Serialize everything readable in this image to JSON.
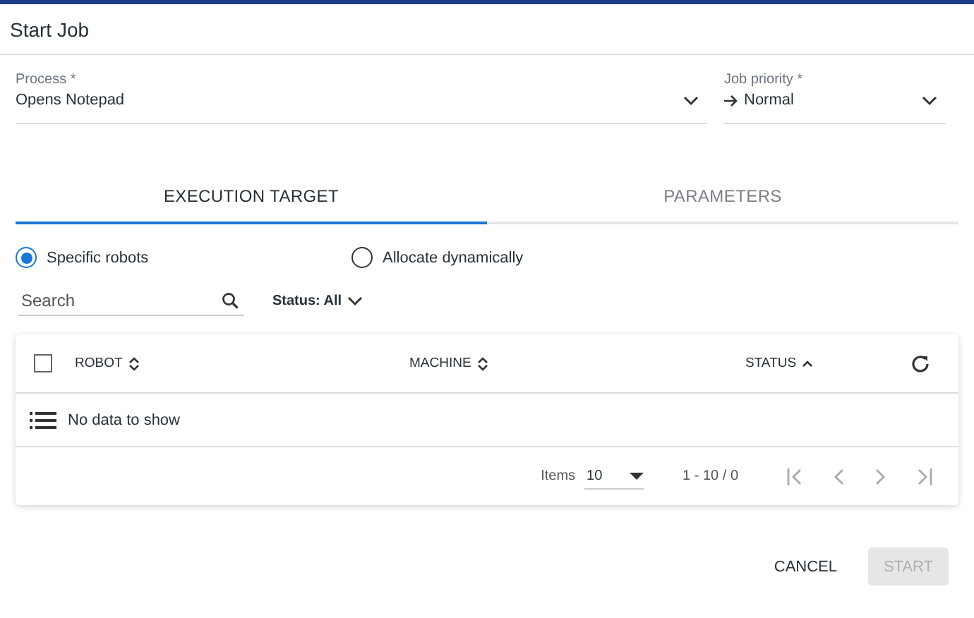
{
  "dialog": {
    "title": "Start Job"
  },
  "process": {
    "label": "Process *",
    "value": "Opens Notepad"
  },
  "priority": {
    "label": "Job priority *",
    "value": "Normal"
  },
  "tabs": [
    {
      "label": "EXECUTION TARGET",
      "selected": true
    },
    {
      "label": "PARAMETERS",
      "selected": false
    }
  ],
  "target_options": [
    {
      "label": "Specific robots",
      "selected": true
    },
    {
      "label": "Allocate dynamically",
      "selected": false
    }
  ],
  "search": {
    "placeholder": "Search"
  },
  "status_filter": "Status: All",
  "table": {
    "all_checked": false,
    "columns": [
      {
        "label": "ROBOT",
        "sorted": false
      },
      {
        "label": "MACHINE",
        "sorted": false
      },
      {
        "label": "STATUS",
        "sorted": true
      }
    ],
    "empty_message": "No data to show",
    "items_label": "Items",
    "page_size": "10",
    "range": "1 - 10 / 0"
  },
  "actions": {
    "cancel": "CANCEL",
    "start": {
      "label": "START",
      "disabled": true
    }
  }
}
